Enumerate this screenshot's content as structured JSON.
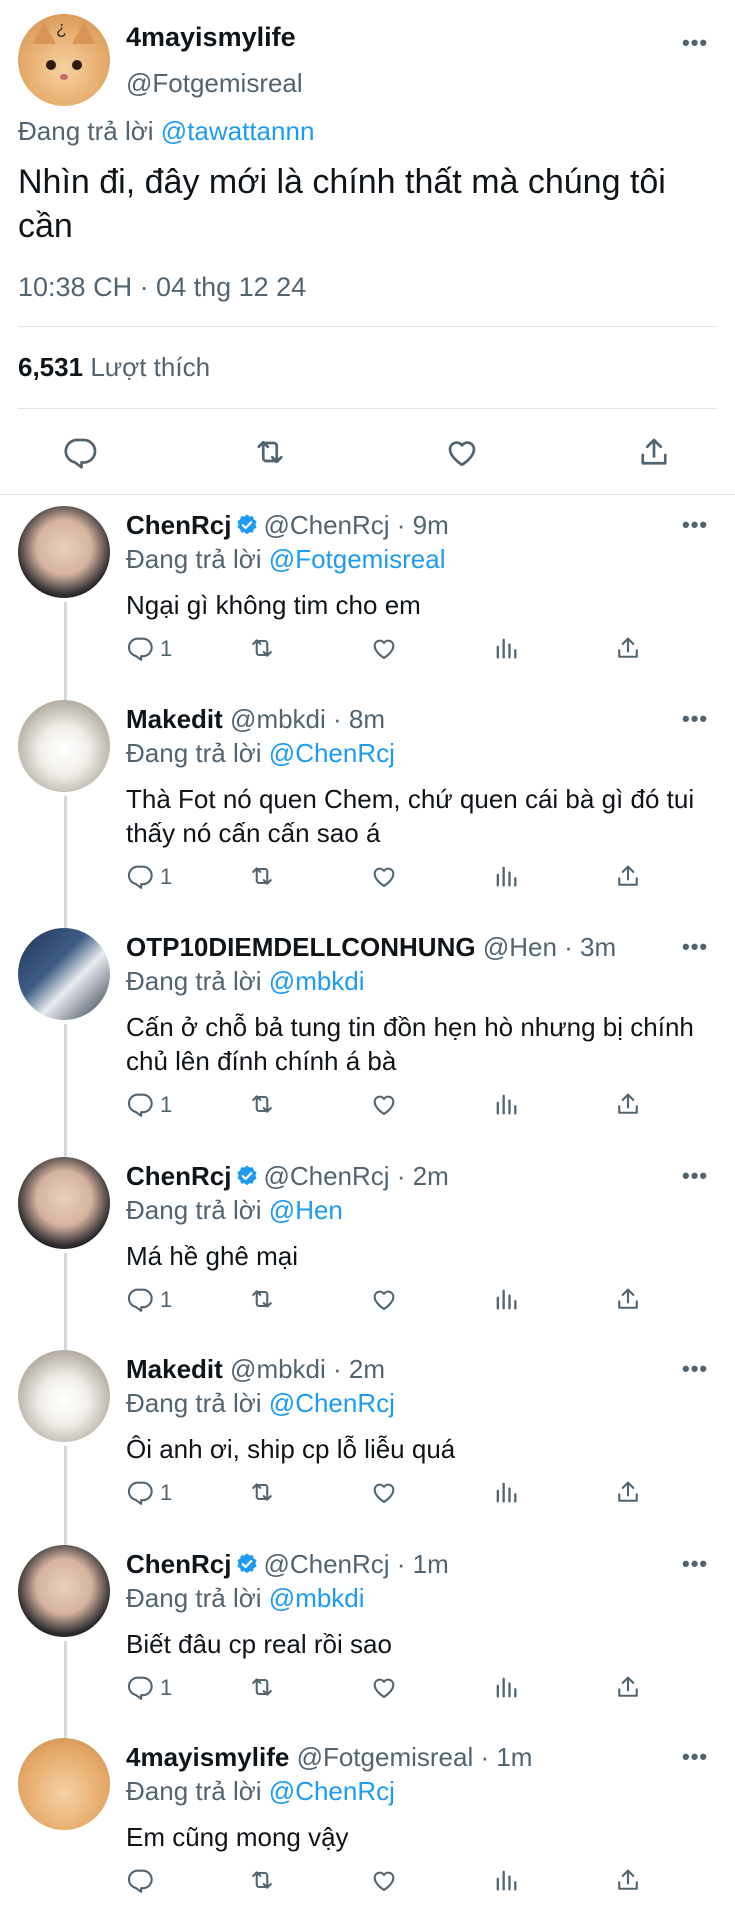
{
  "main_tweet": {
    "author_name": "4mayismylife",
    "author_handle": "@Fotgemisreal",
    "reply_prefix": "Đang trả lời",
    "reply_to": "@tawattannn",
    "text": "Nhìn đi, đây mới là chính thất mà chúng tôi cần",
    "timestamp": "10:38 CH · 04 thg 12 24",
    "likes_count": "6,531",
    "likes_label": "Lượt thích"
  },
  "replies": [
    {
      "name": "ChenRcj",
      "verified": true,
      "handle": "@ChenRcj · 9m",
      "reply_prefix": "Đang trả lời",
      "reply_to": "@Fotgemisreal",
      "text": "Ngại gì không tim cho em",
      "reply_count": "1"
    },
    {
      "name": "Makedit",
      "verified": false,
      "handle": "@mbkdi · 8m",
      "reply_prefix": "Đang trả lời",
      "reply_to": "@ChenRcj",
      "text": "Thà Fot nó quen Chem, chứ quen cái bà gì đó tui thấy nó cấn cấn sao á",
      "reply_count": "1"
    },
    {
      "name": "OTP10DIEMDELLCONHUNG",
      "verified": false,
      "handle": "@Hen · 3m",
      "reply_prefix": "Đang trả lời",
      "reply_to": "@mbkdi",
      "text": "Cấn ở chỗ bả tung tin đồn hẹn hò nhưng bị chính chủ lên đính chính á bà",
      "reply_count": "1"
    },
    {
      "name": "ChenRcj",
      "verified": true,
      "handle": "@ChenRcj · 2m",
      "reply_prefix": "Đang trả lời",
      "reply_to": "@Hen",
      "text": "Má hề ghê mại",
      "reply_count": "1"
    },
    {
      "name": "Makedit",
      "verified": false,
      "handle": "@mbkdi · 2m",
      "reply_prefix": "Đang trả lời",
      "reply_to": "@ChenRcj",
      "text": "Ôi anh ơi, ship cp lỗ liễu quá",
      "reply_count": "1"
    },
    {
      "name": "ChenRcj",
      "verified": true,
      "handle": "@ChenRcj · 1m",
      "reply_prefix": "Đang trả lời",
      "reply_to": "@mbkdi",
      "text": "Biết đâu cp real rồi sao",
      "reply_count": "1"
    },
    {
      "name": "4mayismylife",
      "verified": false,
      "handle": "@Fotgemisreal · 1m",
      "reply_prefix": "Đang trả lời",
      "reply_to": "@ChenRcj",
      "text": "Em cũng mong vậy",
      "reply_count": ""
    }
  ],
  "icons": {
    "more": "more-icon",
    "reply": "reply-icon",
    "retweet": "retweet-icon",
    "like": "heart-icon",
    "analytics": "analytics-icon",
    "share": "share-icon",
    "verified": "verified-badge-icon"
  },
  "colors": {
    "accent": "#1d9bf0",
    "secondary_text": "#536471",
    "primary_text": "#0f1419",
    "divider": "#e1e6ea"
  }
}
